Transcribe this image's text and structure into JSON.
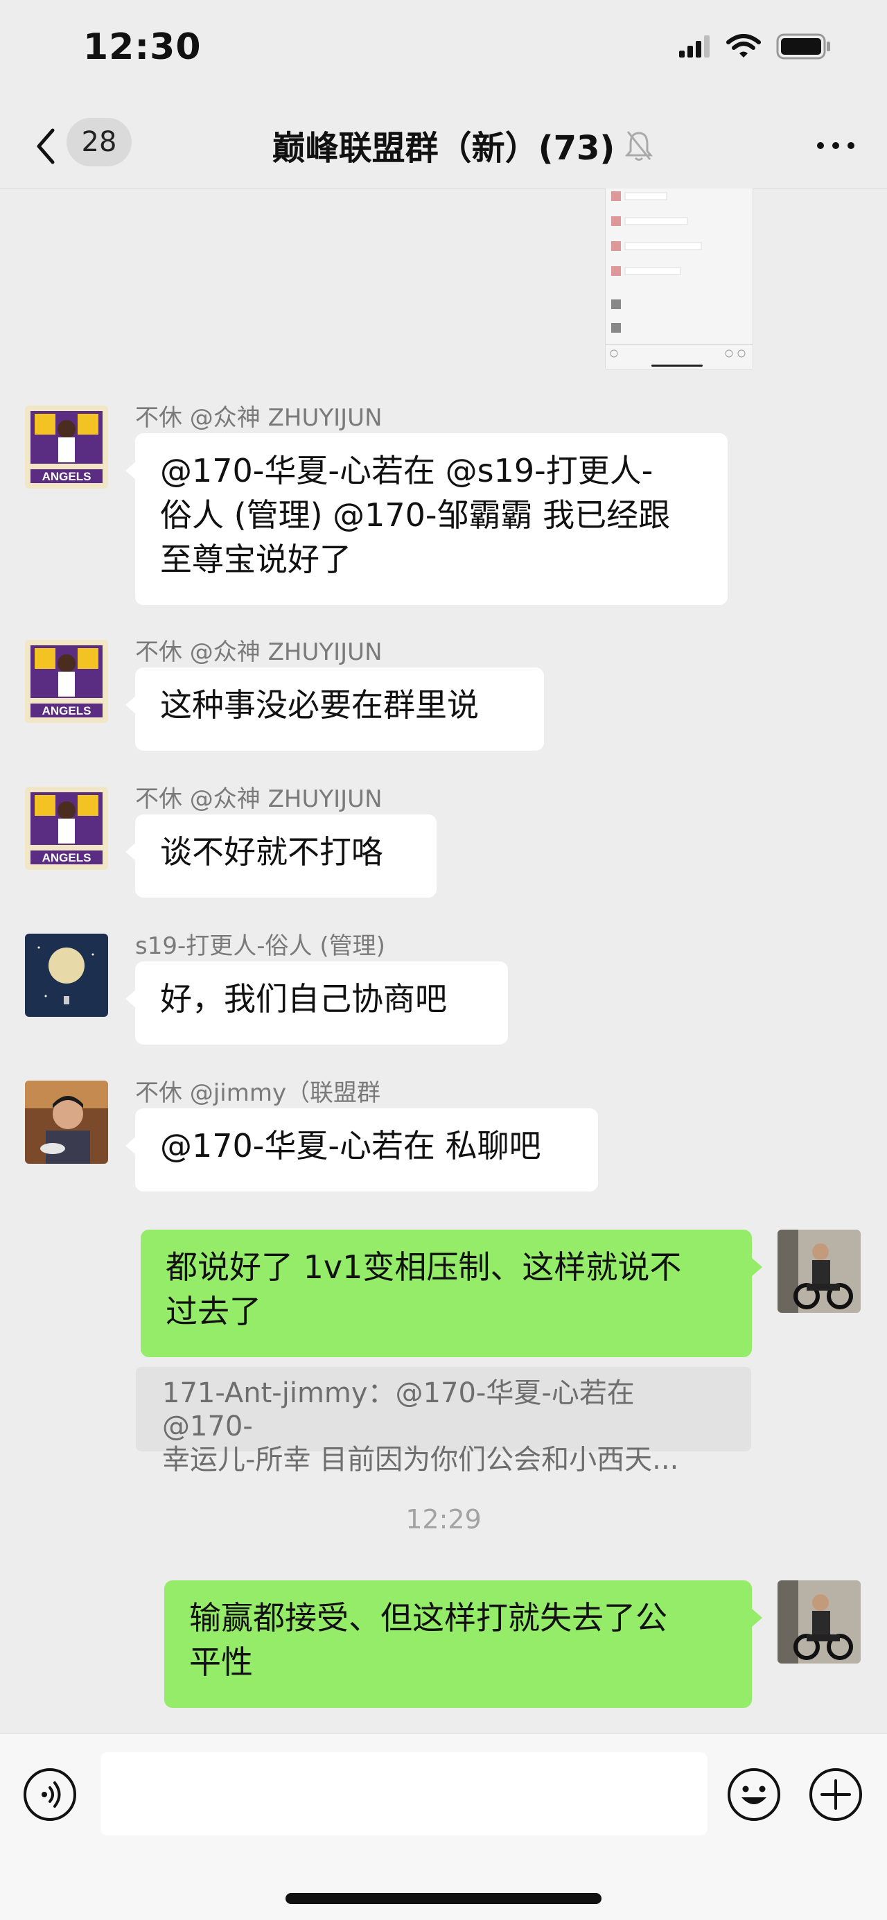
{
  "status_bar": {
    "time": "12:30"
  },
  "nav": {
    "unread_count": "28",
    "title": "巅峰联盟群（新）(73)"
  },
  "messages": [
    {
      "sender": "不休 @众神 ZHUYIJUN",
      "lines": [
        "@170-华夏-心若在 @s19-打更人-",
        "俗人 (管理) @170-邹霸霸 我已经跟",
        "至尊宝说好了"
      ]
    },
    {
      "sender": "不休 @众神 ZHUYIJUN",
      "lines": [
        "这种事没必要在群里说"
      ]
    },
    {
      "sender": "不休 @众神 ZHUYIJUN",
      "lines": [
        "谈不好就不打咯"
      ]
    },
    {
      "sender": "s19-打更人-俗人 (管理)",
      "lines": [
        "好，我们自己协商吧"
      ]
    },
    {
      "sender": "不休 @jimmy（联盟群",
      "lines": [
        "@170-华夏-心若在 私聊吧"
      ]
    },
    {
      "sender": "",
      "lines": [
        "都说好了 1v1变相压制、这样就说不",
        "过去了"
      ]
    },
    {
      "sender": "",
      "lines": [
        "输赢都接受、但这样打就失去了公",
        "平性"
      ]
    }
  ],
  "quote": {
    "lines": [
      "171-Ant-jimmy：@170-华夏-心若在 @170-",
      "幸运儿-所幸 目前因为你们公会和小西天..."
    ]
  },
  "timestamp": "12:29",
  "colors": {
    "my_bubble": "#95ec69",
    "background": "#ededed"
  }
}
